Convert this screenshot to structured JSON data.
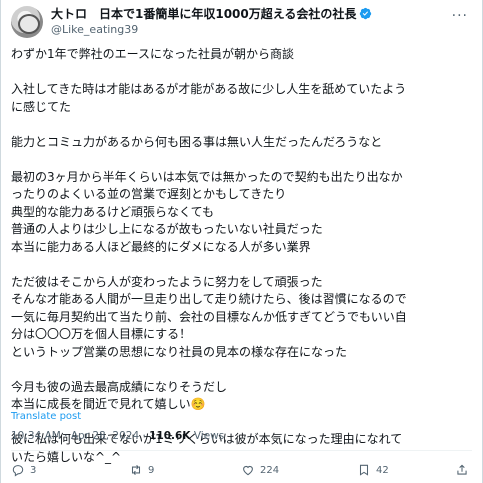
{
  "author": {
    "display_name": "大トロ　日本で1番簡単に年収1000万超える会社の社長",
    "handle": "@Like_eating39"
  },
  "post": {
    "text": "わずか1年で弊社のエースになった社員が朝から商談\n\n入社してきた時は才能はあるが才能がある故に少し人生を舐めていたよう\nに感じてた\n\n能力とコミュ力があるから何も困る事は無い人生だったんだろうなと\n\n最初の3ヶ月から半年くらいは本気では無かったので契約も出たり出なか\nったりのよくいる並の営業で遅刻とかもしてきたり\n典型的な能力あるけど頑張らなくても\n普通の人よりは少し上になるが故もったいない社員だった\n本当に能力ある人ほど最終的にダメになる人が多い業界\n\nただ彼はそこから人が変わったように努力をして頑張った\nそんな才能ある人間が一旦走り出して走り続けたら、後は習慣になるので\n一気に毎月契約出て当たり前、会社の目標なんか低すぎてどうでもいい自\n分は〇〇〇万を個人目標にする！\nというトップ営業の思想になり社員の見本の様な存在になった\n\n今月も彼の過去最高成績になりそうだし\n本当に成長を間近で見れて嬉しい☺️\n\n彼に私は何も出来てないが1ミリくらいは彼が本気になった理由になれて\nいたら嬉しいな^_^",
    "translate_label": "Translate post",
    "time": "10:34 AM",
    "date": "Apr 28, 2024",
    "separator": " · ",
    "views_count": "110.6K",
    "views_label": "Views"
  },
  "actions": {
    "replies": "3",
    "reposts": "9",
    "likes": "224",
    "bookmarks": "42"
  },
  "icons": [
    "avatar",
    "verified-badge-icon",
    "more-options-icon",
    "reply-icon",
    "repost-icon",
    "like-icon",
    "bookmark-icon",
    "share-icon"
  ],
  "colors": {
    "verified": "#1d9bf0",
    "link": "#1d9bf0",
    "muted": "#536471"
  }
}
